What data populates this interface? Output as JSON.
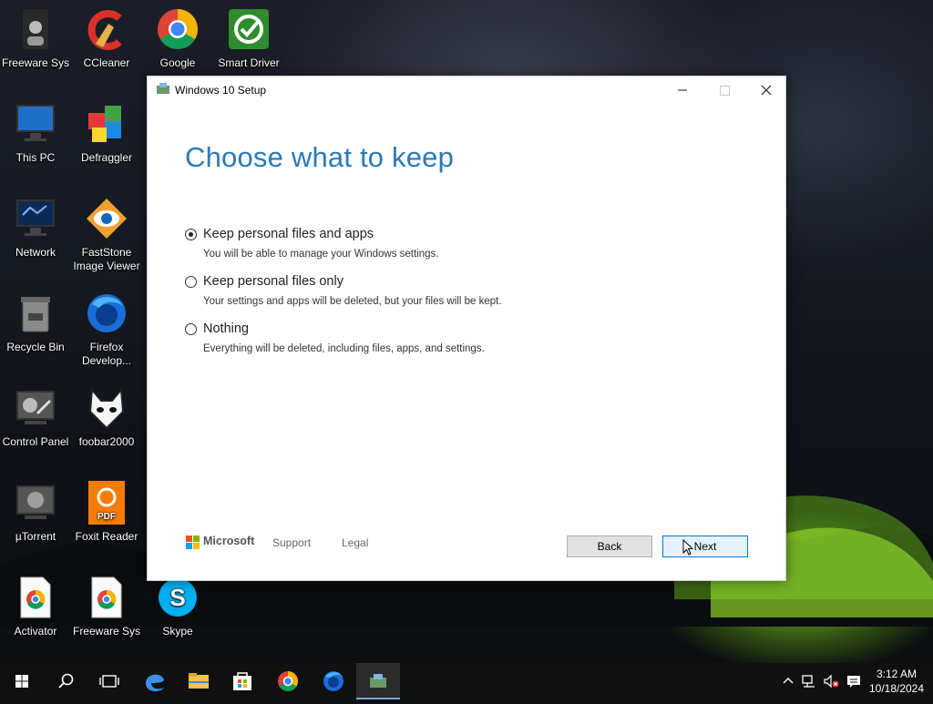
{
  "desktop": {
    "icons": [
      {
        "label": "Freeware Sys",
        "icon": "user-app-icon"
      },
      {
        "label": "CCleaner",
        "icon": "ccleaner-icon"
      },
      {
        "label": "Google Chrome",
        "icon": "chrome-icon"
      },
      {
        "label": "Smart Driver Updater",
        "icon": "smart-driver-icon"
      },
      {
        "label": "This PC",
        "icon": "monitor-icon"
      },
      {
        "label": "Defraggler",
        "icon": "defraggler-icon"
      },
      {
        "label": "Network",
        "icon": "network-icon"
      },
      {
        "label": "FastStone Image Viewer",
        "icon": "faststone-icon"
      },
      {
        "label": "Recycle Bin",
        "icon": "recycle-bin-icon"
      },
      {
        "label": "Firefox Develop...",
        "icon": "firefox-dev-icon"
      },
      {
        "label": "Control Panel",
        "icon": "control-panel-icon"
      },
      {
        "label": "foobar2000",
        "icon": "foobar-icon"
      },
      {
        "label": "µTorrent",
        "icon": "utorrent-icon"
      },
      {
        "label": "Foxit Reader",
        "icon": "foxit-icon"
      },
      {
        "label": "Activator",
        "icon": "chrome-doc-icon"
      },
      {
        "label": "Freeware Sys",
        "icon": "chrome-doc-icon"
      },
      {
        "label": "Skype",
        "icon": "skype-icon"
      }
    ]
  },
  "window": {
    "title": "Windows 10 Setup",
    "heading": "Choose what to keep",
    "options": [
      {
        "label": "Keep personal files and apps",
        "description": "You will be able to manage your Windows settings.",
        "selected": true
      },
      {
        "label": "Keep personal files only",
        "description": "Your settings and apps will be deleted, but your files will be kept.",
        "selected": false
      },
      {
        "label": "Nothing",
        "description": "Everything will be deleted, including files, apps, and settings.",
        "selected": false
      }
    ],
    "footer": {
      "brand": "Microsoft",
      "support": "Support",
      "legal": "Legal",
      "back": "Back",
      "next": "Next"
    }
  },
  "taskbar": {
    "clock_time": "3:12 AM",
    "clock_date": "10/18/2024"
  },
  "colors": {
    "accent": "#2a7ab8",
    "next_border": "#0078d7"
  }
}
